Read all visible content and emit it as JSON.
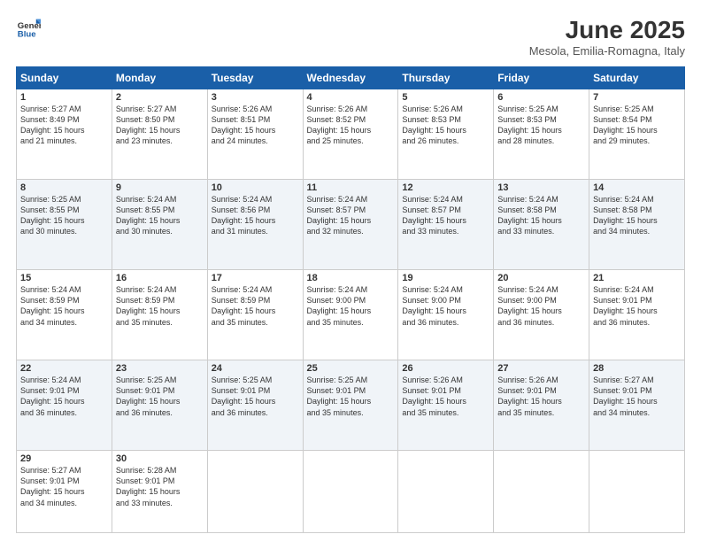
{
  "logo": {
    "line1": "General",
    "line2": "Blue"
  },
  "title": "June 2025",
  "location": "Mesola, Emilia-Romagna, Italy",
  "days_of_week": [
    "Sunday",
    "Monday",
    "Tuesday",
    "Wednesday",
    "Thursday",
    "Friday",
    "Saturday"
  ],
  "weeks": [
    [
      {
        "day": 1,
        "lines": [
          "Sunrise: 5:27 AM",
          "Sunset: 8:49 PM",
          "Daylight: 15 hours",
          "and 21 minutes."
        ]
      },
      {
        "day": 2,
        "lines": [
          "Sunrise: 5:27 AM",
          "Sunset: 8:50 PM",
          "Daylight: 15 hours",
          "and 23 minutes."
        ]
      },
      {
        "day": 3,
        "lines": [
          "Sunrise: 5:26 AM",
          "Sunset: 8:51 PM",
          "Daylight: 15 hours",
          "and 24 minutes."
        ]
      },
      {
        "day": 4,
        "lines": [
          "Sunrise: 5:26 AM",
          "Sunset: 8:52 PM",
          "Daylight: 15 hours",
          "and 25 minutes."
        ]
      },
      {
        "day": 5,
        "lines": [
          "Sunrise: 5:26 AM",
          "Sunset: 8:53 PM",
          "Daylight: 15 hours",
          "and 26 minutes."
        ]
      },
      {
        "day": 6,
        "lines": [
          "Sunrise: 5:25 AM",
          "Sunset: 8:53 PM",
          "Daylight: 15 hours",
          "and 28 minutes."
        ]
      },
      {
        "day": 7,
        "lines": [
          "Sunrise: 5:25 AM",
          "Sunset: 8:54 PM",
          "Daylight: 15 hours",
          "and 29 minutes."
        ]
      }
    ],
    [
      {
        "day": 8,
        "lines": [
          "Sunrise: 5:25 AM",
          "Sunset: 8:55 PM",
          "Daylight: 15 hours",
          "and 30 minutes."
        ]
      },
      {
        "day": 9,
        "lines": [
          "Sunrise: 5:24 AM",
          "Sunset: 8:55 PM",
          "Daylight: 15 hours",
          "and 30 minutes."
        ]
      },
      {
        "day": 10,
        "lines": [
          "Sunrise: 5:24 AM",
          "Sunset: 8:56 PM",
          "Daylight: 15 hours",
          "and 31 minutes."
        ]
      },
      {
        "day": 11,
        "lines": [
          "Sunrise: 5:24 AM",
          "Sunset: 8:57 PM",
          "Daylight: 15 hours",
          "and 32 minutes."
        ]
      },
      {
        "day": 12,
        "lines": [
          "Sunrise: 5:24 AM",
          "Sunset: 8:57 PM",
          "Daylight: 15 hours",
          "and 33 minutes."
        ]
      },
      {
        "day": 13,
        "lines": [
          "Sunrise: 5:24 AM",
          "Sunset: 8:58 PM",
          "Daylight: 15 hours",
          "and 33 minutes."
        ]
      },
      {
        "day": 14,
        "lines": [
          "Sunrise: 5:24 AM",
          "Sunset: 8:58 PM",
          "Daylight: 15 hours",
          "and 34 minutes."
        ]
      }
    ],
    [
      {
        "day": 15,
        "lines": [
          "Sunrise: 5:24 AM",
          "Sunset: 8:59 PM",
          "Daylight: 15 hours",
          "and 34 minutes."
        ]
      },
      {
        "day": 16,
        "lines": [
          "Sunrise: 5:24 AM",
          "Sunset: 8:59 PM",
          "Daylight: 15 hours",
          "and 35 minutes."
        ]
      },
      {
        "day": 17,
        "lines": [
          "Sunrise: 5:24 AM",
          "Sunset: 8:59 PM",
          "Daylight: 15 hours",
          "and 35 minutes."
        ]
      },
      {
        "day": 18,
        "lines": [
          "Sunrise: 5:24 AM",
          "Sunset: 9:00 PM",
          "Daylight: 15 hours",
          "and 35 minutes."
        ]
      },
      {
        "day": 19,
        "lines": [
          "Sunrise: 5:24 AM",
          "Sunset: 9:00 PM",
          "Daylight: 15 hours",
          "and 36 minutes."
        ]
      },
      {
        "day": 20,
        "lines": [
          "Sunrise: 5:24 AM",
          "Sunset: 9:00 PM",
          "Daylight: 15 hours",
          "and 36 minutes."
        ]
      },
      {
        "day": 21,
        "lines": [
          "Sunrise: 5:24 AM",
          "Sunset: 9:01 PM",
          "Daylight: 15 hours",
          "and 36 minutes."
        ]
      }
    ],
    [
      {
        "day": 22,
        "lines": [
          "Sunrise: 5:24 AM",
          "Sunset: 9:01 PM",
          "Daylight: 15 hours",
          "and 36 minutes."
        ]
      },
      {
        "day": 23,
        "lines": [
          "Sunrise: 5:25 AM",
          "Sunset: 9:01 PM",
          "Daylight: 15 hours",
          "and 36 minutes."
        ]
      },
      {
        "day": 24,
        "lines": [
          "Sunrise: 5:25 AM",
          "Sunset: 9:01 PM",
          "Daylight: 15 hours",
          "and 36 minutes."
        ]
      },
      {
        "day": 25,
        "lines": [
          "Sunrise: 5:25 AM",
          "Sunset: 9:01 PM",
          "Daylight: 15 hours",
          "and 35 minutes."
        ]
      },
      {
        "day": 26,
        "lines": [
          "Sunrise: 5:26 AM",
          "Sunset: 9:01 PM",
          "Daylight: 15 hours",
          "and 35 minutes."
        ]
      },
      {
        "day": 27,
        "lines": [
          "Sunrise: 5:26 AM",
          "Sunset: 9:01 PM",
          "Daylight: 15 hours",
          "and 35 minutes."
        ]
      },
      {
        "day": 28,
        "lines": [
          "Sunrise: 5:27 AM",
          "Sunset: 9:01 PM",
          "Daylight: 15 hours",
          "and 34 minutes."
        ]
      }
    ],
    [
      {
        "day": 29,
        "lines": [
          "Sunrise: 5:27 AM",
          "Sunset: 9:01 PM",
          "Daylight: 15 hours",
          "and 34 minutes."
        ]
      },
      {
        "day": 30,
        "lines": [
          "Sunrise: 5:28 AM",
          "Sunset: 9:01 PM",
          "Daylight: 15 hours",
          "and 33 minutes."
        ]
      },
      null,
      null,
      null,
      null,
      null
    ]
  ]
}
